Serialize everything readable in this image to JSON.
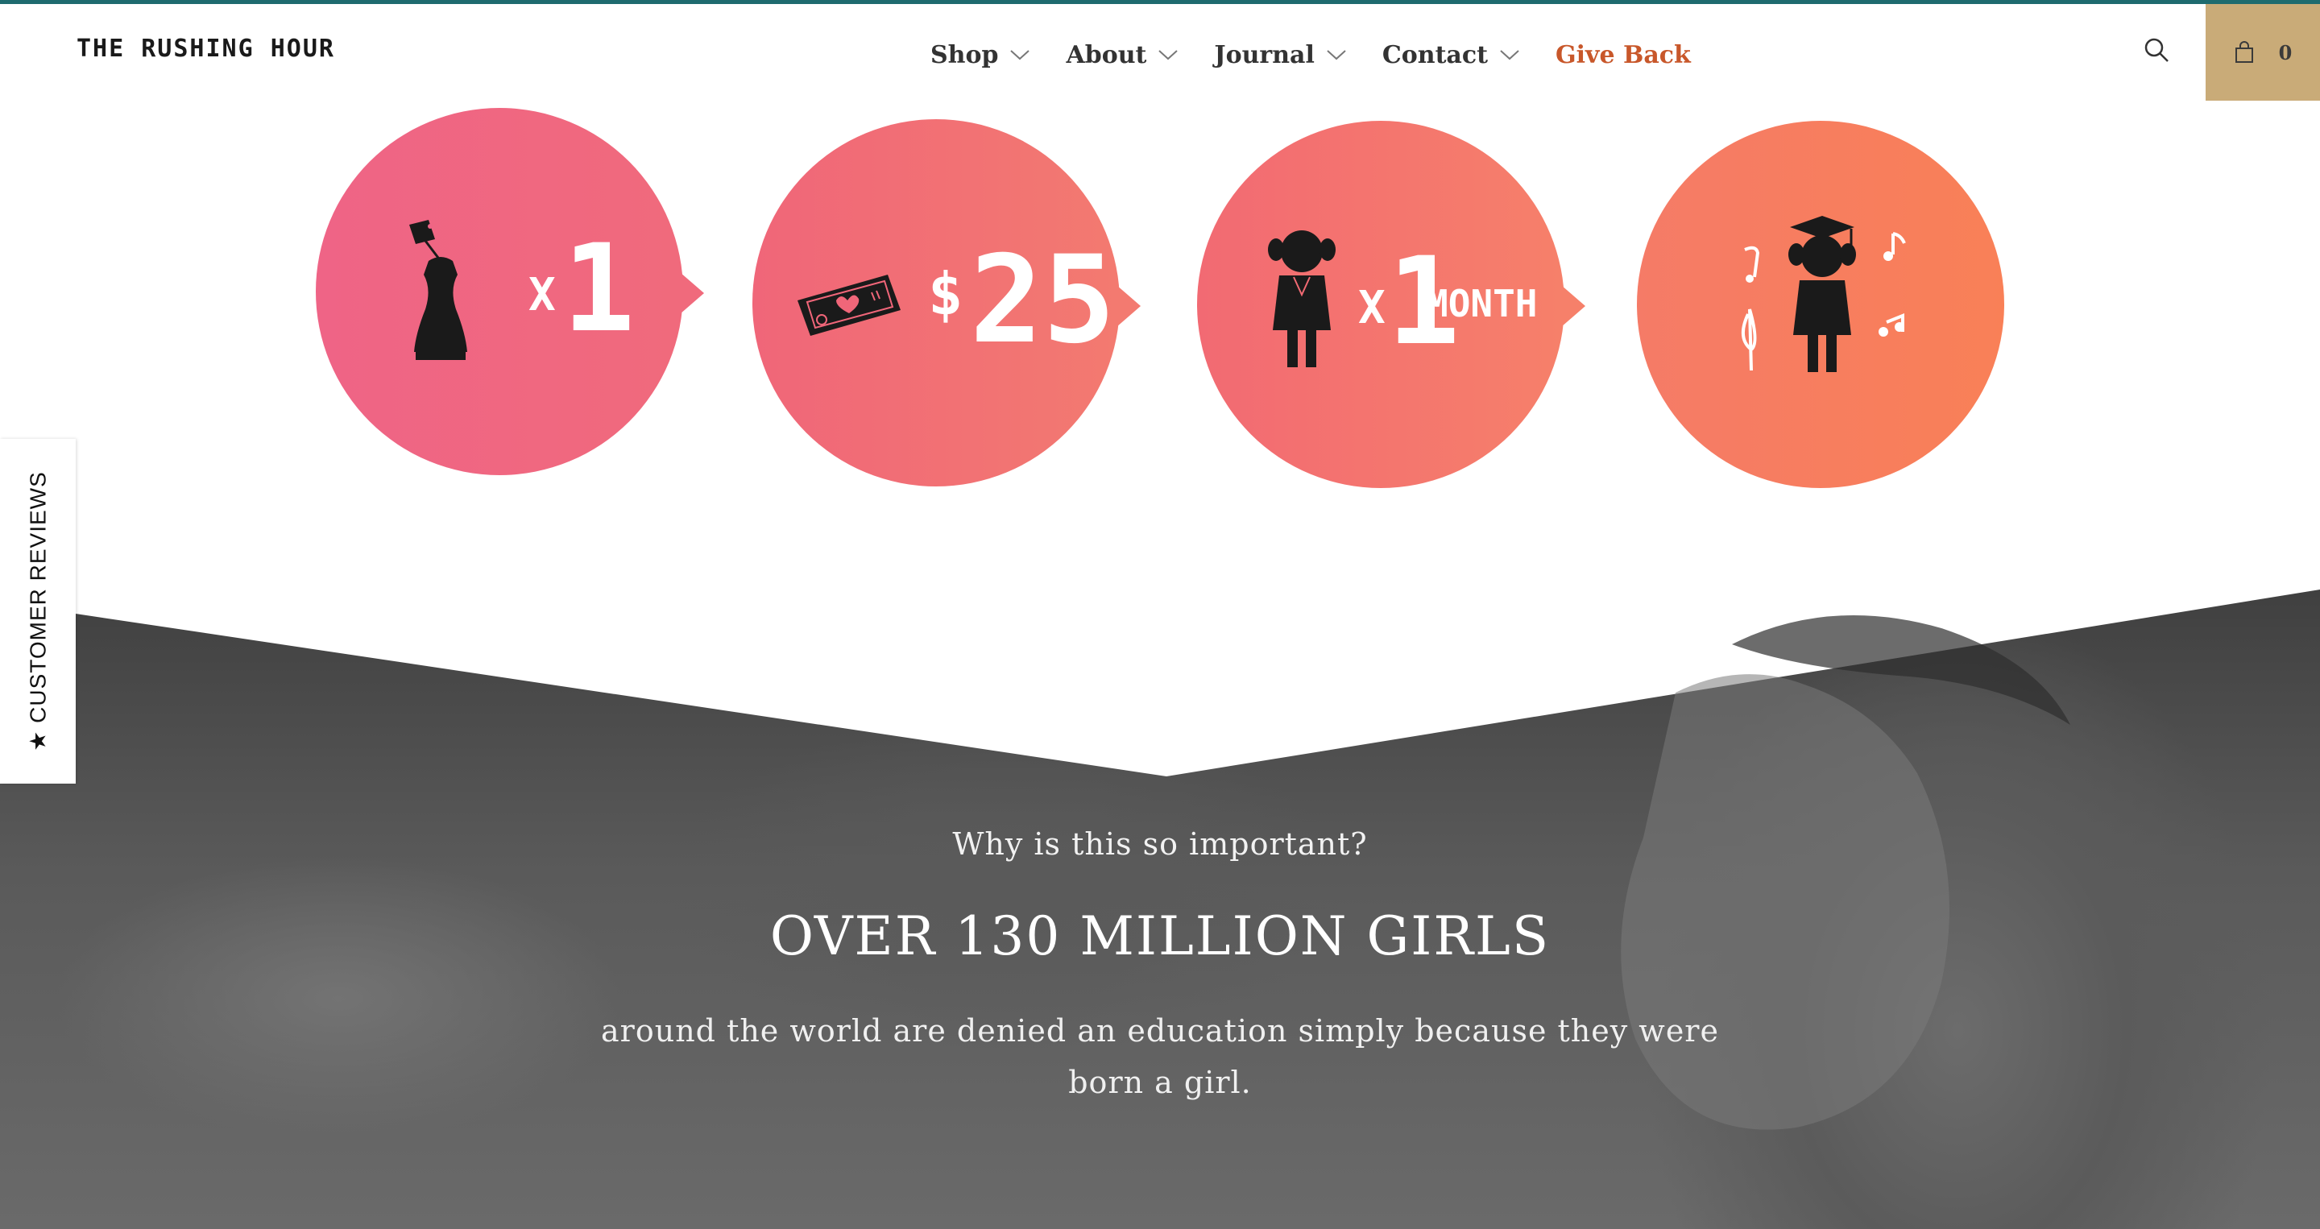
{
  "header": {
    "logo": "THE RUSHING HOUR",
    "nav": [
      {
        "label": "Shop",
        "has_dropdown": true
      },
      {
        "label": "About",
        "has_dropdown": true
      },
      {
        "label": "Journal",
        "has_dropdown": true
      },
      {
        "label": "Contact",
        "has_dropdown": true
      },
      {
        "label": "Give Back",
        "has_dropdown": false
      }
    ],
    "search_icon": "search-icon",
    "cart_icon": "shopping-bag-icon",
    "cart_count": "0"
  },
  "steps": [
    {
      "icon": "dress-form-tag-icon",
      "prefix": "X",
      "value": "1",
      "suffix": ""
    },
    {
      "icon": "money-heart-icon",
      "prefix": "$",
      "value": "25",
      "suffix": ""
    },
    {
      "icon": "girl-icon",
      "prefix": "X",
      "value": "1",
      "suffix": "MONTH"
    },
    {
      "icon": "graduate-girl-music-icon",
      "prefix": "",
      "value": "",
      "suffix": ""
    }
  ],
  "reviews_tab": {
    "label": "★ CUSTOMER REVIEWS"
  },
  "hero": {
    "question": "Why is this so important?",
    "headline": "OVER 130 MILLION GIRLS",
    "body": "around the world are denied an education simply because they were born a girl."
  },
  "colors": {
    "accent_give_back": "#c8572a",
    "cart_bg": "#c9ab78",
    "top_bar": "#1e6b6f",
    "circle_1": "#ef6486",
    "circle_4": "#f98057"
  }
}
